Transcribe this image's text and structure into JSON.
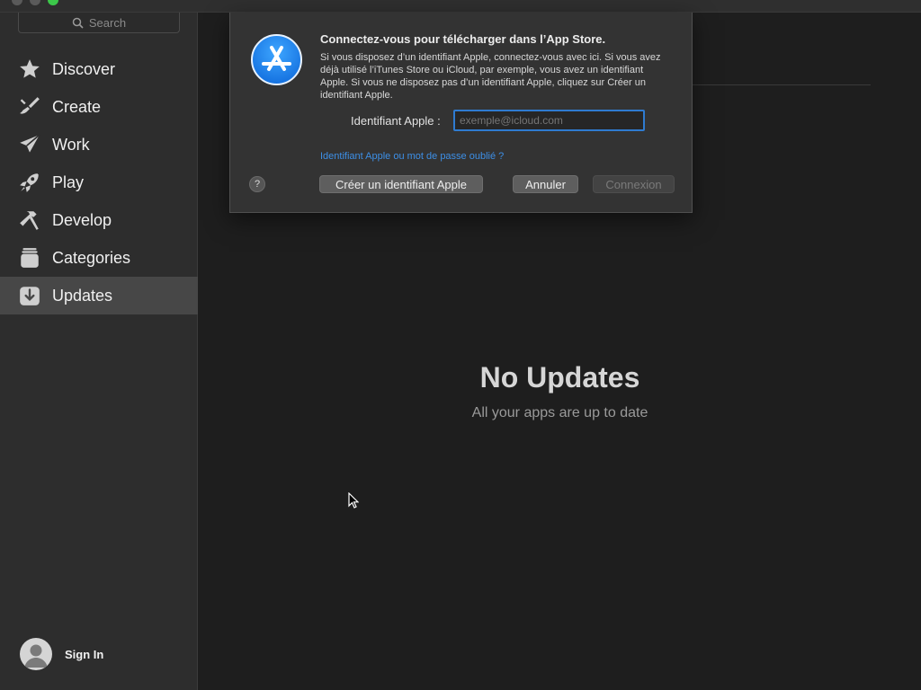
{
  "sidebar": {
    "search_placeholder": "Search",
    "items": [
      {
        "label": "Discover",
        "icon": "star-icon"
      },
      {
        "label": "Create",
        "icon": "brush-icon"
      },
      {
        "label": "Work",
        "icon": "paper-plane-icon"
      },
      {
        "label": "Play",
        "icon": "rocket-icon"
      },
      {
        "label": "Develop",
        "icon": "hammer-icon"
      },
      {
        "label": "Categories",
        "icon": "stack-icon"
      },
      {
        "label": "Updates",
        "icon": "download-icon",
        "active": true
      }
    ],
    "sign_in_label": "Sign In"
  },
  "main": {
    "empty_title": "No Updates",
    "empty_subtitle": "All your apps are up to date"
  },
  "dialog": {
    "title": "Connectez-vous pour télécharger dans l’App Store.",
    "body": "Si vous disposez d’un identifiant Apple, connectez-vous avec ici. Si vous avez déjà utilisé l’iTunes Store ou iCloud, par exemple, vous avez un identifiant Apple. Si vous ne disposez pas d’un identifiant Apple, cliquez sur Créer un identifiant Apple.",
    "field_label": "Identifiant Apple :",
    "field_placeholder": "exemple@icloud.com",
    "forgot_link": "Identifiant Apple ou mot de passe oublié ?",
    "help_label": "?",
    "create_button": "Créer un identifiant Apple",
    "cancel_button": "Annuler",
    "connect_button": "Connexion"
  },
  "colors": {
    "accent": "#2f7bd0",
    "link": "#3d8fe6",
    "sidebar_bg": "#2d2d2d",
    "active_bg": "#474747"
  }
}
